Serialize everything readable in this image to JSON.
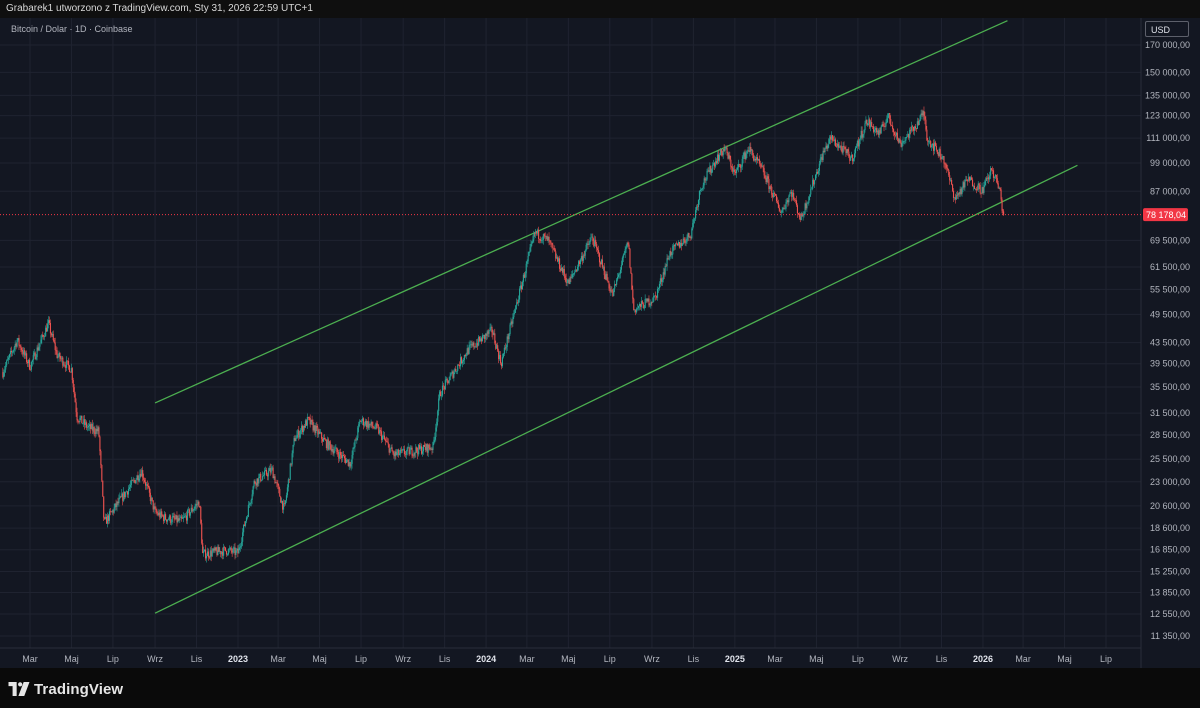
{
  "header": {
    "caption": "Grabarek1 utworzono z TradingView.com, Sty 31, 2026 22:59 UTC+1"
  },
  "brand": {
    "name": "TradingView",
    "icon": "tradingview-logo-icon"
  },
  "chart_data": {
    "type": "candlestick",
    "title": "Bitcoin / Dolar · 1D · Coinbase",
    "currency_label": "USD",
    "scale": "log",
    "colors": {
      "up": "#26a69a",
      "down": "#ef5350",
      "channel": "#4caf50",
      "last_price": "#f23645",
      "background": "#131722",
      "grid": "#1f2330"
    },
    "y_ticks": [
      170000,
      150000,
      135000,
      123000,
      111000,
      99000,
      87000,
      69500,
      61500,
      55500,
      49500,
      43500,
      39500,
      35500,
      31500,
      28500,
      25500,
      23000,
      20600,
      18600,
      16850,
      15250,
      13850,
      12550,
      11350
    ],
    "y_tick_labels": [
      "170 000,00",
      "150 000,00",
      "135 000,00",
      "123 000,00",
      "111 000,00",
      "99 000,00",
      "87 000,00",
      "69 500,00",
      "61 500,00",
      "55 500,00",
      "49 500,00",
      "43 500,00",
      "39 500,00",
      "35 500,00",
      "31 500,00",
      "28 500,00",
      "25 500,00",
      "23 000,00",
      "20 600,00",
      "18 600,00",
      "16 850,00",
      "15 250,00",
      "13 850,00",
      "12 550,00",
      "11 350,00"
    ],
    "x_ticks": [
      {
        "date": "2022-03-01",
        "label": "Mar",
        "bold": false
      },
      {
        "date": "2022-05-01",
        "label": "Maj",
        "bold": false
      },
      {
        "date": "2022-07-01",
        "label": "Lip",
        "bold": false
      },
      {
        "date": "2022-09-01",
        "label": "Wrz",
        "bold": false
      },
      {
        "date": "2022-11-01",
        "label": "Lis",
        "bold": false
      },
      {
        "date": "2023-01-01",
        "label": "2023",
        "bold": true
      },
      {
        "date": "2023-03-01",
        "label": "Mar",
        "bold": false
      },
      {
        "date": "2023-05-01",
        "label": "Maj",
        "bold": false
      },
      {
        "date": "2023-07-01",
        "label": "Lip",
        "bold": false
      },
      {
        "date": "2023-09-01",
        "label": "Wrz",
        "bold": false
      },
      {
        "date": "2023-11-01",
        "label": "Lis",
        "bold": false
      },
      {
        "date": "2024-01-01",
        "label": "2024",
        "bold": true
      },
      {
        "date": "2024-03-01",
        "label": "Mar",
        "bold": false
      },
      {
        "date": "2024-05-01",
        "label": "Maj",
        "bold": false
      },
      {
        "date": "2024-07-01",
        "label": "Lip",
        "bold": false
      },
      {
        "date": "2024-09-01",
        "label": "Wrz",
        "bold": false
      },
      {
        "date": "2024-11-01",
        "label": "Lis",
        "bold": false
      },
      {
        "date": "2025-01-01",
        "label": "2025",
        "bold": true
      },
      {
        "date": "2025-03-01",
        "label": "Mar",
        "bold": false
      },
      {
        "date": "2025-05-01",
        "label": "Maj",
        "bold": false
      },
      {
        "date": "2025-07-01",
        "label": "Lip",
        "bold": false
      },
      {
        "date": "2025-09-01",
        "label": "Wrz",
        "bold": false
      },
      {
        "date": "2025-11-01",
        "label": "Lis",
        "bold": false
      },
      {
        "date": "2026-01-01",
        "label": "2026",
        "bold": true
      },
      {
        "date": "2026-03-01",
        "label": "Mar",
        "bold": false
      },
      {
        "date": "2026-05-01",
        "label": "Maj",
        "bold": false
      },
      {
        "date": "2026-07-01",
        "label": "Lip",
        "bold": false
      }
    ],
    "last_price": 78178.04,
    "last_price_label": "78 178,04",
    "price_path": [
      [
        "2022-01-20",
        38000
      ],
      [
        "2022-02-10",
        44000
      ],
      [
        "2022-03-01",
        39000
      ],
      [
        "2022-03-28",
        47500
      ],
      [
        "2022-04-10",
        41000
      ],
      [
        "2022-05-01",
        38500
      ],
      [
        "2022-05-09",
        31000
      ],
      [
        "2022-05-25",
        29500
      ],
      [
        "2022-06-10",
        29000
      ],
      [
        "2022-06-18",
        19000
      ],
      [
        "2022-07-10",
        21000
      ],
      [
        "2022-08-12",
        24200
      ],
      [
        "2022-09-01",
        20000
      ],
      [
        "2022-09-15",
        19500
      ],
      [
        "2022-10-10",
        19200
      ],
      [
        "2022-11-05",
        21000
      ],
      [
        "2022-11-10",
        16500
      ],
      [
        "2022-12-15",
        16800
      ],
      [
        "2023-01-01",
        16600
      ],
      [
        "2023-01-25",
        23000
      ],
      [
        "2023-02-20",
        24300
      ],
      [
        "2023-03-10",
        20200
      ],
      [
        "2023-03-25",
        28000
      ],
      [
        "2023-04-14",
        30500
      ],
      [
        "2023-05-10",
        27500
      ],
      [
        "2023-06-15",
        25000
      ],
      [
        "2023-06-30",
        30500
      ],
      [
        "2023-07-25",
        29300
      ],
      [
        "2023-08-18",
        26000
      ],
      [
        "2023-09-15",
        26500
      ],
      [
        "2023-10-15",
        27000
      ],
      [
        "2023-10-25",
        34500
      ],
      [
        "2023-12-05",
        42000
      ],
      [
        "2024-01-10",
        46000
      ],
      [
        "2024-01-23",
        39500
      ],
      [
        "2024-02-15",
        52000
      ],
      [
        "2024-03-13",
        72000
      ],
      [
        "2024-04-01",
        69500
      ],
      [
        "2024-05-01",
        57000
      ],
      [
        "2024-06-05",
        70500
      ],
      [
        "2024-07-05",
        54000
      ],
      [
        "2024-07-28",
        69000
      ],
      [
        "2024-08-05",
        50500
      ],
      [
        "2024-09-06",
        53500
      ],
      [
        "2024-09-27",
        65500
      ],
      [
        "2024-10-28",
        71500
      ],
      [
        "2024-11-12",
        89000
      ],
      [
        "2024-12-05",
        101000
      ],
      [
        "2024-12-17",
        106000
      ],
      [
        "2025-01-01",
        94000
      ],
      [
        "2025-01-21",
        106000
      ],
      [
        "2025-02-10",
        96000
      ],
      [
        "2025-03-10",
        79000
      ],
      [
        "2025-03-25",
        87000
      ],
      [
        "2025-04-08",
        76500
      ],
      [
        "2025-05-10",
        103000
      ],
      [
        "2025-05-22",
        111000
      ],
      [
        "2025-06-22",
        101000
      ],
      [
        "2025-07-14",
        120000
      ],
      [
        "2025-08-02",
        113000
      ],
      [
        "2025-08-14",
        123000
      ],
      [
        "2025-09-01",
        108000
      ],
      [
        "2025-09-20",
        115500
      ],
      [
        "2025-10-06",
        124500
      ],
      [
        "2025-10-11",
        111000
      ],
      [
        "2025-11-04",
        101000
      ],
      [
        "2025-11-21",
        84000
      ],
      [
        "2025-12-10",
        92000
      ],
      [
        "2025-12-31",
        87500
      ],
      [
        "2026-01-14",
        96000
      ],
      [
        "2026-01-25",
        88000
      ],
      [
        "2026-01-31",
        78178
      ]
    ],
    "channel": {
      "upper": [
        [
          "2022-09-01",
          33000
        ],
        [
          "2026-02-06",
          190000
        ]
      ],
      "lower": [
        [
          "2022-09-01",
          12600
        ],
        [
          "2026-05-20",
          98000
        ]
      ]
    }
  }
}
